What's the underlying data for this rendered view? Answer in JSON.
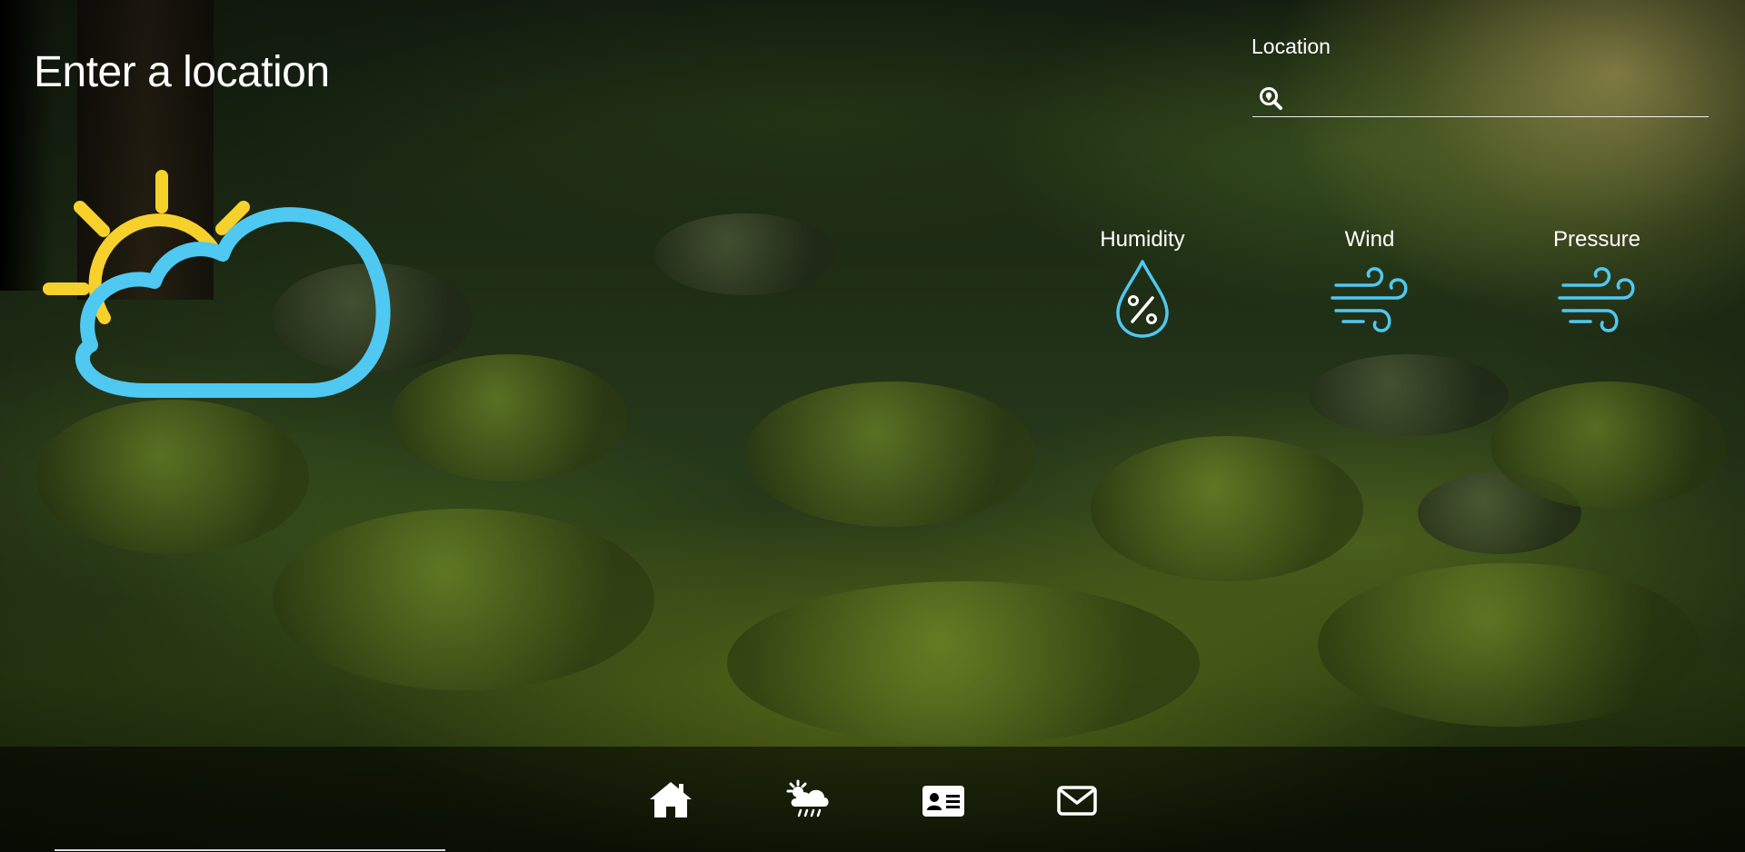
{
  "header": {
    "title": "Enter a location"
  },
  "search": {
    "label": "Location",
    "value": "",
    "placeholder": ""
  },
  "weather": {
    "icon": "partly-cloudy-icon",
    "sun_color": "#f7d12b",
    "cloud_color": "#4fc8f2"
  },
  "stats": [
    {
      "label": "Humidity",
      "icon": "humidity-drop-icon"
    },
    {
      "label": "Wind",
      "icon": "wind-icon"
    },
    {
      "label": "Pressure",
      "icon": "wind-icon"
    }
  ],
  "nav": [
    {
      "icon": "home-icon"
    },
    {
      "icon": "weather-icon"
    },
    {
      "icon": "contact-card-icon"
    },
    {
      "icon": "mail-icon"
    }
  ],
  "colors": {
    "accent": "#4fc8f2",
    "sun": "#f7d12b",
    "text": "#ffffff"
  }
}
